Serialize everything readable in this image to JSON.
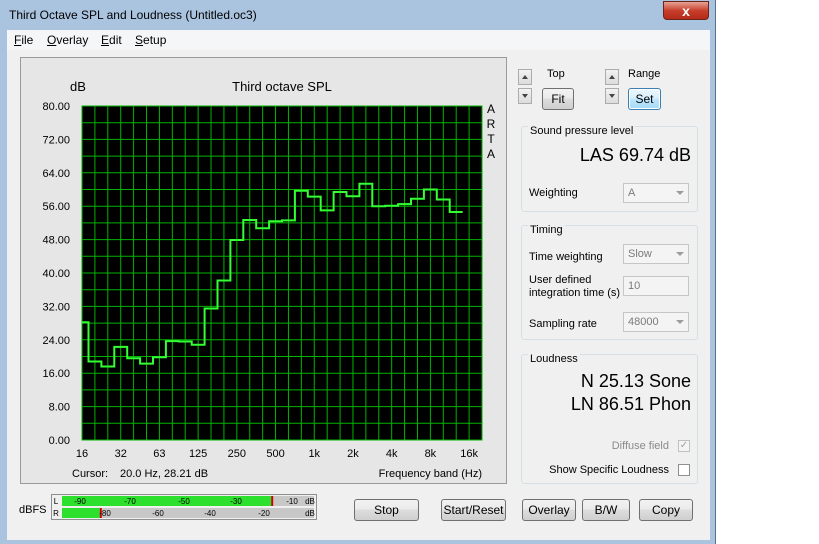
{
  "window": {
    "title": "Third Octave SPL and Loudness (Untitled.oc3)",
    "close_glyph": "x"
  },
  "menu": [
    {
      "acc": "F",
      "rest": "ile"
    },
    {
      "acc": "O",
      "rest": "verlay"
    },
    {
      "acc": "E",
      "rest": "dit"
    },
    {
      "acc": "S",
      "rest": "etup"
    }
  ],
  "chart_data": {
    "type": "line",
    "title": "Third octave SPL",
    "ylabel": "dB",
    "xlabel": "Frequency band (Hz)",
    "watermark": [
      "A",
      "R",
      "T",
      "A"
    ],
    "ylim": [
      0,
      80
    ],
    "y_ticks": [
      "0.00",
      "8.00",
      "16.00",
      "24.00",
      "32.00",
      "40.00",
      "48.00",
      "56.00",
      "64.00",
      "72.00",
      "80.00"
    ],
    "x_tick_labels": [
      "16",
      "32",
      "63",
      "125",
      "250",
      "500",
      "1k",
      "2k",
      "4k",
      "8k",
      "16k"
    ],
    "bands_hz": [
      "16",
      "20",
      "25",
      "31.5",
      "40",
      "50",
      "63",
      "80",
      "100",
      "125",
      "160",
      "200",
      "250",
      "315",
      "400",
      "500",
      "630",
      "800",
      "1k",
      "1.25k",
      "1.6k",
      "2k",
      "2.5k",
      "3.15k",
      "4k",
      "5k",
      "6.3k",
      "8k",
      "10k",
      "12.5k",
      "16k",
      "20k"
    ],
    "values": [
      28.2,
      18.8,
      17.6,
      22.3,
      19.6,
      18.3,
      19.8,
      23.7,
      23.6,
      22.8,
      31.5,
      38.2,
      47.9,
      52.7,
      50.7,
      52.4,
      52.6,
      59.7,
      58.3,
      55.0,
      59.4,
      58.4,
      61.4,
      56.0,
      56.1,
      56.5,
      57.8,
      60.0,
      57.6,
      54.6
    ],
    "grid": true,
    "colors": {
      "background": "#000000",
      "grid": "#00b400",
      "trace": "#33ff33"
    },
    "cursor_label": "Cursor:",
    "cursor_value": "20.0 Hz, 28.21 dB"
  },
  "top_controls": {
    "top_label": "Top",
    "fit_button": "Fit",
    "range_label": "Range",
    "set_button": "Set"
  },
  "spl": {
    "group_title": "Sound pressure level",
    "value": "LAS 69.74 dB",
    "weighting_label": "Weighting",
    "weighting_value": "A"
  },
  "timing": {
    "group_title": "Timing",
    "time_weighting_label": "Time weighting",
    "time_weighting_value": "Slow",
    "integration_label_line1": "User defined",
    "integration_label_line2": "integration time (s)",
    "integration_value": "10",
    "sampling_rate_label": "Sampling rate",
    "sampling_rate_value": "48000"
  },
  "loudness": {
    "group_title": "Loudness",
    "n_value": "N 25.13 Sone",
    "ln_value": "LN 86.51 Phon",
    "diffuse_label": "Diffuse field",
    "diffuse_checked": true,
    "specific_label": "Show Specific Loudness",
    "specific_checked": false
  },
  "meter": {
    "label": "dBFS",
    "l_channel": "L",
    "r_channel": "R",
    "l_ticks": [
      "-90",
      "-70",
      "-50",
      "-30",
      "-10",
      "dB"
    ],
    "r_ticks": [
      "-80",
      "-60",
      "-40",
      "-20",
      "dB"
    ],
    "l_level": 0.83,
    "r_level": 0.15,
    "colors": {
      "fill": "#2ee02e",
      "peak": "#cc0000",
      "track": "#c8c8c8"
    }
  },
  "buttons": {
    "stop": "Stop",
    "start_reset": "Start/Reset",
    "overlay": "Overlay",
    "bw": "B/W",
    "copy": "Copy"
  }
}
